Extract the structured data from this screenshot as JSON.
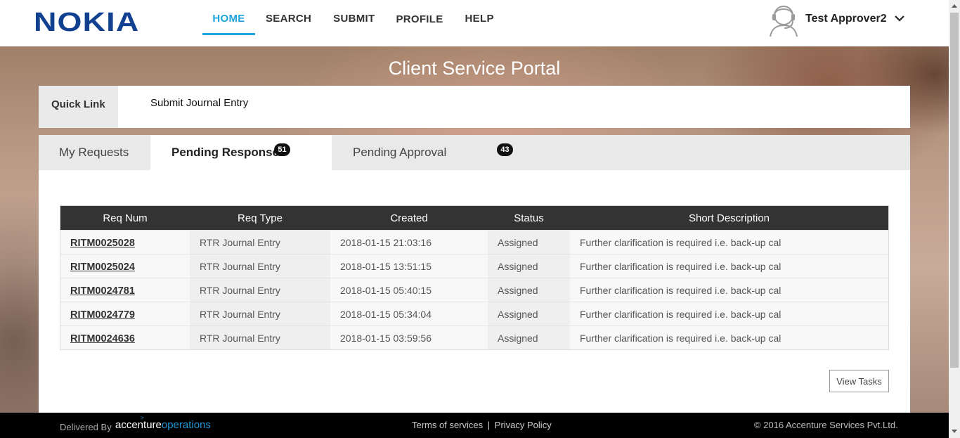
{
  "header": {
    "logo": "NOKIA",
    "nav": [
      "HOME",
      "SEARCH",
      "SUBMIT",
      "PROFILE",
      "HELP"
    ],
    "user_name": "Test Approver2",
    "brand_color": "#124191",
    "active_color": "#1fa3dd"
  },
  "portal_title": "Client Service Portal",
  "quick_link": {
    "label": "Quick Link",
    "link": "Submit Journal Entry"
  },
  "tabs": [
    {
      "label": "My Requests"
    },
    {
      "label": "Pending Response",
      "count": "51"
    },
    {
      "label": "Pending Approval",
      "count": "43"
    }
  ],
  "table": {
    "headers": [
      "Req Num",
      "Req Type",
      "Created",
      "Status",
      "Short Description"
    ],
    "rows": [
      [
        "RITM0025028",
        "RTR Journal Entry",
        "2018-01-15 21:03:16",
        "Assigned",
        "Further clarification is required i.e. back-up cal"
      ],
      [
        "RITM0025024",
        "RTR Journal Entry",
        "2018-01-15 13:51:15",
        "Assigned",
        "Further clarification is required i.e. back-up cal"
      ],
      [
        "RITM0024781",
        "RTR Journal Entry",
        "2018-01-15 05:40:15",
        "Assigned",
        "Further clarification is required i.e. back-up cal"
      ],
      [
        "RITM0024779",
        "RTR Journal Entry",
        "2018-01-15 05:34:04",
        "Assigned",
        "Further clarification is required i.e. back-up cal"
      ],
      [
        "RITM0024636",
        "RTR Journal Entry",
        "2018-01-15 03:59:56",
        "Assigned",
        "Further clarification is required i.e. back-up cal"
      ]
    ]
  },
  "view_tasks": "View Tasks",
  "footer": {
    "delivered_by": "Delivered By",
    "accenture_1": "accenture",
    "accenture_2": "operations",
    "terms": "Terms of services",
    "separator": "|",
    "privacy": "Privacy Policy",
    "copyright": "© 2016 Accenture Services Pvt.Ltd."
  }
}
